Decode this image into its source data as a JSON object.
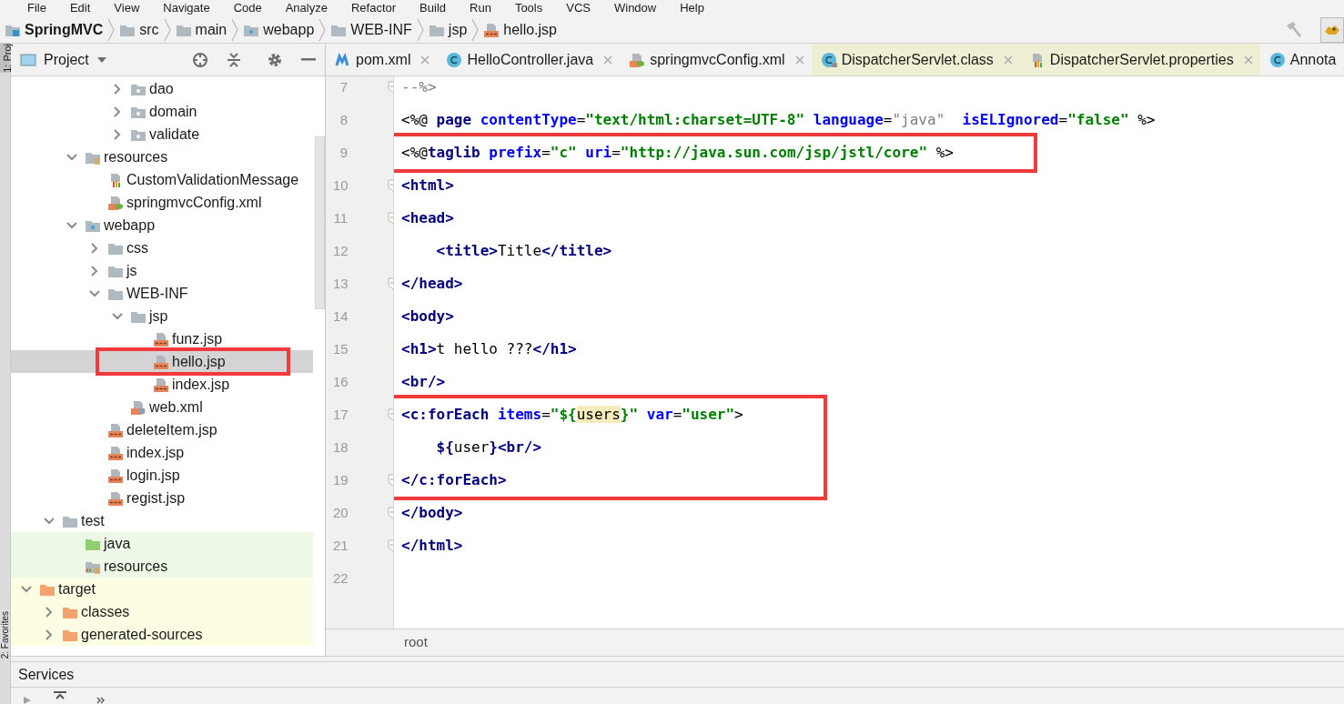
{
  "menu": [
    "File",
    "Edit",
    "View",
    "Navigate",
    "Code",
    "Analyze",
    "Refactor",
    "Build",
    "Run",
    "Tools",
    "VCS",
    "Window",
    "Help"
  ],
  "breadcrumbs": [
    {
      "label": "SpringMVC",
      "kind": "module"
    },
    {
      "label": "src",
      "kind": "folder"
    },
    {
      "label": "main",
      "kind": "folder"
    },
    {
      "label": "webapp",
      "kind": "web-folder"
    },
    {
      "label": "WEB-INF",
      "kind": "folder"
    },
    {
      "label": "jsp",
      "kind": "folder"
    },
    {
      "label": "hello.jsp",
      "kind": "jsp"
    }
  ],
  "side_strip": {
    "top": "1: Proj",
    "bottom": "2: Favorites"
  },
  "project_panel": {
    "title": "Project",
    "tree": [
      {
        "children": [
          {
            "children": [
              {
                "children": [
                  {
                    "children": [
                      {
                        "children": [
                          {
                            "label": "dao",
                            "kind": "package",
                            "expanded": false,
                            "selected": false
                          },
                          {
                            "label": "domain",
                            "kind": "package",
                            "expanded": false,
                            "selected": false
                          },
                          {
                            "label": "validate",
                            "kind": "package",
                            "expanded": false,
                            "selected": false
                          }
                        ]
                      }
                    ]
                  },
                  {
                    "label": "resources",
                    "kind": "resources-folder",
                    "expanded": true,
                    "selected": false,
                    "children": [
                      {
                        "label": "CustomValidationMessage",
                        "kind": "properties",
                        "selected": false
                      },
                      {
                        "label": "springmvcConfig.xml",
                        "kind": "spring-xml",
                        "selected": false
                      }
                    ]
                  },
                  {
                    "label": "webapp",
                    "kind": "web-folder",
                    "expanded": true,
                    "selected": false,
                    "children": [
                      {
                        "label": "css",
                        "kind": "folder",
                        "expanded": false,
                        "selected": false
                      },
                      {
                        "label": "js",
                        "kind": "folder",
                        "expanded": false,
                        "selected": false
                      },
                      {
                        "label": "WEB-INF",
                        "kind": "folder",
                        "expanded": true,
                        "selected": false,
                        "children": [
                          {
                            "label": "jsp",
                            "kind": "folder",
                            "expanded": true,
                            "selected": false,
                            "children": [
                              {
                                "label": "funz.jsp",
                                "kind": "jsp",
                                "selected": false,
                                "boxed": false
                              },
                              {
                                "label": "hello.jsp",
                                "kind": "jsp",
                                "selected": true,
                                "boxed": true
                              },
                              {
                                "label": "index.jsp",
                                "kind": "jsp",
                                "selected": false,
                                "boxed": false
                              }
                            ]
                          },
                          {
                            "label": "web.xml",
                            "kind": "web-xml",
                            "selected": false
                          }
                        ]
                      },
                      {
                        "label": "deleteItem.jsp",
                        "kind": "jsp",
                        "selected": false
                      },
                      {
                        "label": "index.jsp",
                        "kind": "jsp",
                        "selected": false
                      },
                      {
                        "label": "login.jsp",
                        "kind": "jsp",
                        "selected": false
                      },
                      {
                        "label": "regist.jsp",
                        "kind": "jsp",
                        "selected": false
                      }
                    ]
                  }
                ]
              },
              {
                "label": "test",
                "kind": "folder",
                "expanded": true,
                "selected": false,
                "children": [
                  {
                    "label": "java",
                    "kind": "test-source-folder",
                    "selected": false
                  },
                  {
                    "label": "resources",
                    "kind": "test-resources-folder",
                    "selected": false
                  }
                ]
              }
            ]
          },
          {
            "label": "target",
            "kind": "excluded-folder",
            "expanded": true,
            "selected": false,
            "children": [
              {
                "label": "classes",
                "kind": "excluded-folder",
                "expanded": false,
                "selected": false
              },
              {
                "label": "generated-sources",
                "kind": "excluded-folder",
                "expanded": false,
                "selected": false
              }
            ]
          }
        ]
      }
    ]
  },
  "tabs": [
    {
      "label": "pom.xml",
      "kind": "maven",
      "library": false,
      "closable": true
    },
    {
      "label": "HelloController.java",
      "kind": "class",
      "library": false,
      "closable": true
    },
    {
      "label": "springmvcConfig.xml",
      "kind": "spring-xml",
      "library": false,
      "closable": true
    },
    {
      "label": "DispatcherServlet.class",
      "kind": "compiled-class",
      "library": true,
      "closable": true
    },
    {
      "label": "DispatcherServlet.properties",
      "kind": "properties",
      "library": true,
      "closable": true
    },
    {
      "label": "Annota",
      "kind": "class",
      "library": false,
      "closable": false
    }
  ],
  "editor": {
    "lines": [
      {
        "number": "7",
        "fold": true,
        "boxed": false,
        "tokens": [
          {
            "kind": "comment",
            "text": "--%>"
          }
        ]
      },
      {
        "number": "8",
        "boxed": false,
        "tokens": [
          {
            "kind": "plain",
            "text": "<%@ "
          },
          {
            "kind": "tag",
            "text": "page"
          },
          {
            "kind": "attr",
            "text": " contentType"
          },
          {
            "kind": "plain",
            "text": "="
          },
          {
            "kind": "value",
            "text": "\"text/html:charset=UTF-8\""
          },
          {
            "kind": "attr",
            "text": " language"
          },
          {
            "kind": "plain",
            "text": "="
          },
          {
            "kind": "muted",
            "text": "\"java\""
          },
          {
            "kind": "attr",
            "text": "  isELIgnored"
          },
          {
            "kind": "plain",
            "text": "="
          },
          {
            "kind": "value",
            "text": "\"false\""
          },
          {
            "kind": "plain",
            "text": " %>"
          }
        ]
      },
      {
        "number": "9",
        "boxed": true,
        "tokens": [
          {
            "kind": "plain",
            "text": "<%@"
          },
          {
            "kind": "tag",
            "text": "taglib"
          },
          {
            "kind": "attr",
            "text": " prefix"
          },
          {
            "kind": "plain",
            "text": "="
          },
          {
            "kind": "value",
            "text": "\"c\""
          },
          {
            "kind": "attr",
            "text": " uri"
          },
          {
            "kind": "plain",
            "text": "="
          },
          {
            "kind": "value",
            "text": "\"http://java.sun.com/jsp/jstl/core\""
          },
          {
            "kind": "plain",
            "text": " %>"
          }
        ]
      },
      {
        "number": "10",
        "fold": true,
        "boxed": false,
        "tokens": [
          {
            "kind": "tag",
            "text": "<html>"
          }
        ]
      },
      {
        "number": "11",
        "fold": true,
        "boxed": false,
        "tokens": [
          {
            "kind": "tag",
            "text": "<head>"
          }
        ]
      },
      {
        "number": "12",
        "boxed": false,
        "tokens": [
          {
            "kind": "tag",
            "text": "    <title>"
          },
          {
            "kind": "plain",
            "text": "Title"
          },
          {
            "kind": "tag",
            "text": "</title>"
          }
        ]
      },
      {
        "number": "13",
        "fold": true,
        "boxed": false,
        "tokens": [
          {
            "kind": "tag",
            "text": "</head>"
          }
        ]
      },
      {
        "number": "14",
        "boxed": false,
        "tokens": [
          {
            "kind": "tag",
            "text": "<body>"
          }
        ]
      },
      {
        "number": "15",
        "boxed": false,
        "tokens": [
          {
            "kind": "tag",
            "text": "<h1>"
          },
          {
            "kind": "plain",
            "text": "t hello ???"
          },
          {
            "kind": "tag",
            "text": "</h1>"
          }
        ]
      },
      {
        "number": "16",
        "boxed": false,
        "tokens": [
          {
            "kind": "tag",
            "text": "<br/>"
          }
        ]
      },
      {
        "number": "17",
        "fold": true,
        "boxed": true,
        "tokens": [
          {
            "kind": "tag",
            "text": "<c:forEach"
          },
          {
            "kind": "attr",
            "text": " items"
          },
          {
            "kind": "plain",
            "text": "="
          },
          {
            "kind": "value",
            "text": "\"${"
          },
          {
            "kind": "usage",
            "text": "users"
          },
          {
            "kind": "value",
            "text": "}\""
          },
          {
            "kind": "attr",
            "text": " var"
          },
          {
            "kind": "plain",
            "text": "="
          },
          {
            "kind": "value",
            "text": "\"user\""
          },
          {
            "kind": "plain",
            "text": ">"
          }
        ]
      },
      {
        "number": "18",
        "boxed": true,
        "tokens": [
          {
            "kind": "el",
            "text": "    ${"
          },
          {
            "kind": "plain",
            "text": "user"
          },
          {
            "kind": "el",
            "text": "}"
          },
          {
            "kind": "tag",
            "text": "<br/>"
          }
        ]
      },
      {
        "number": "19",
        "fold": true,
        "boxed": true,
        "tokens": [
          {
            "kind": "tag",
            "text": "</c:forEach>"
          }
        ]
      },
      {
        "number": "20",
        "fold": true,
        "boxed": false,
        "tokens": [
          {
            "kind": "tag",
            "text": "</body>"
          }
        ]
      },
      {
        "number": "21",
        "fold": true,
        "boxed": false,
        "tokens": [
          {
            "kind": "tag",
            "text": "</html>"
          }
        ]
      },
      {
        "number": "22"
      }
    ],
    "breadcrumb": "root"
  },
  "services": {
    "title": "Services"
  }
}
